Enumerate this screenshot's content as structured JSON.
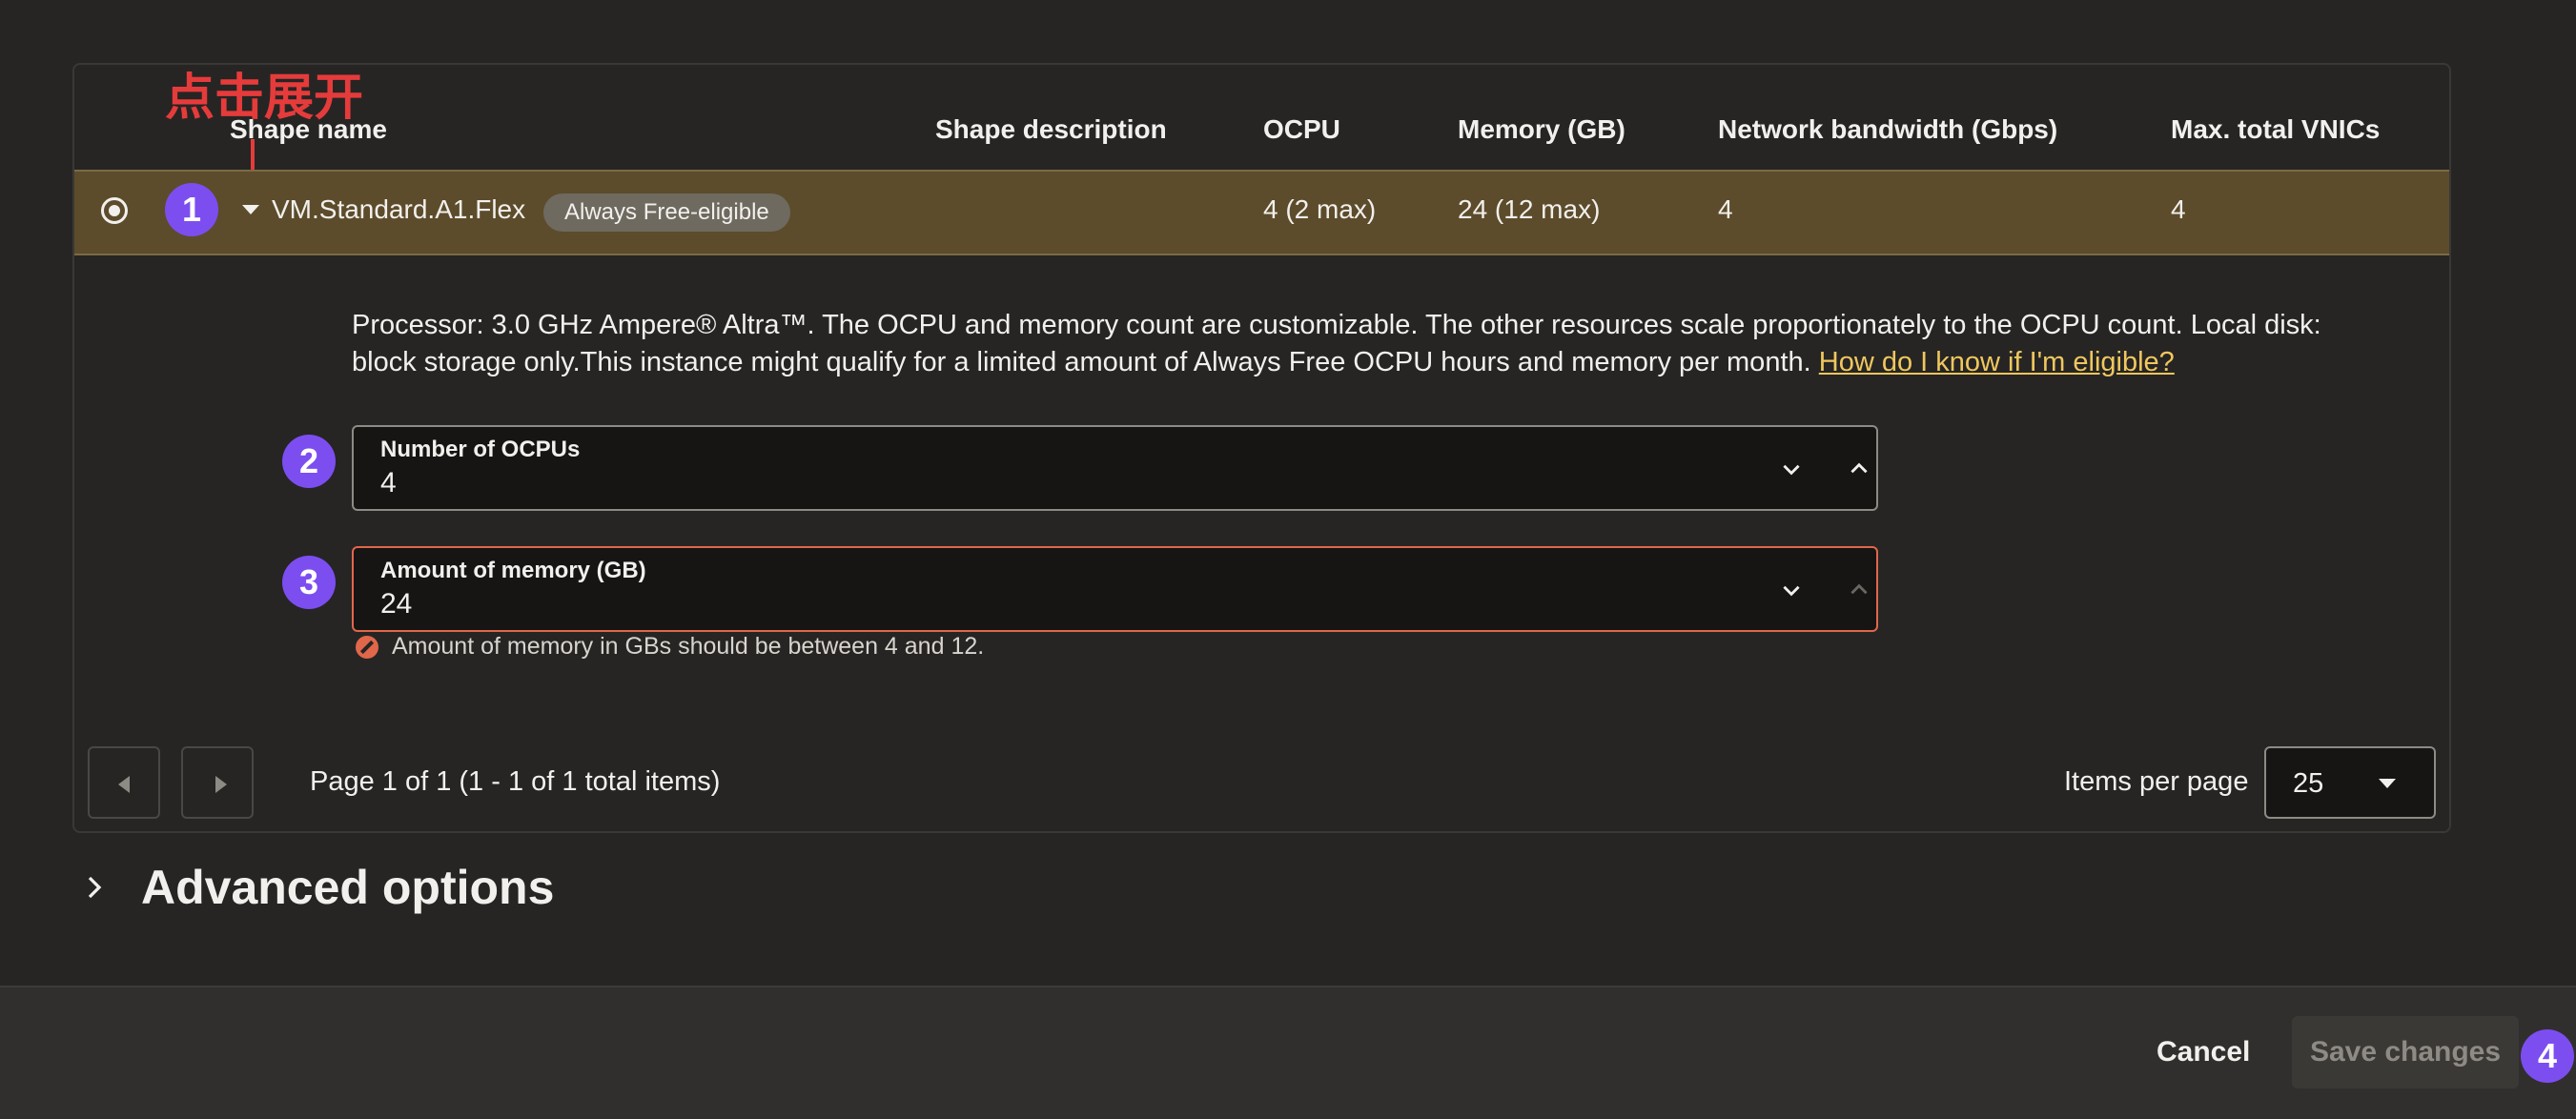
{
  "annotation": {
    "text": "点击展开"
  },
  "table": {
    "headers": {
      "shape_name": "Shape name",
      "shape_description": "Shape description",
      "ocpu": "OCPU",
      "memory": "Memory (GB)",
      "network": "Network bandwidth (Gbps)",
      "vnics": "Max. total VNICs"
    },
    "row": {
      "shape_name": "VM.Standard.A1.Flex",
      "badge": "Always Free-eligible",
      "ocpu": "4 (2 max)",
      "memory": "24 (12 max)",
      "network": "4",
      "vnics": "4"
    }
  },
  "details": {
    "description": "Processor: 3.0 GHz Ampere® Altra™. The OCPU and memory count are customizable. The other resources scale proportionately to the OCPU count. Local disk: block storage only.This instance might qualify for a limited amount of Always Free OCPU hours and memory per month.",
    "eligibility_link": "How do I know if I'm eligible?",
    "ocpu_field": {
      "label": "Number of OCPUs",
      "value": "4"
    },
    "memory_field": {
      "label": "Amount of memory (GB)",
      "value": "24"
    },
    "memory_error": "Amount of memory in GBs should be between 4 and 12."
  },
  "steps": {
    "one": "1",
    "two": "2",
    "three": "3",
    "four": "4"
  },
  "pagination": {
    "info": "Page 1 of 1 (1 - 1 of 1 total items)",
    "items_per_page_label": "Items per page",
    "items_per_page_value": "25"
  },
  "advanced": {
    "title": "Advanced options"
  },
  "footer": {
    "cancel": "Cancel",
    "save": "Save changes"
  },
  "colors": {
    "selected_row": "#5c4c2b",
    "step_badge": "#7c4ef0",
    "error": "#e0674a",
    "link": "#f0c75e",
    "annotation": "#e63b3b"
  }
}
